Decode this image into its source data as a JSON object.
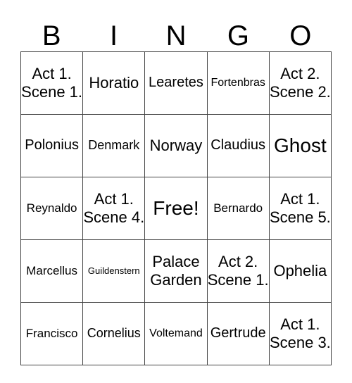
{
  "header": [
    "B",
    "I",
    "N",
    "G",
    "O"
  ],
  "rows": [
    [
      "Act 1. Scene 1.",
      "Horatio",
      "Learetes",
      "Fortenbras",
      "Act 2. Scene 2."
    ],
    [
      "Polonius",
      "Denmark",
      "Norway",
      "Claudius",
      "Ghost"
    ],
    [
      "Reynaldo",
      "Act 1. Scene 4.",
      "Free!",
      "Bernardo",
      "Act 1. Scene 5."
    ],
    [
      "Marcellus",
      "Guildenstern",
      "Palace Garden",
      "Act 2. Scene 1.",
      "Ophelia"
    ],
    [
      "Francisco",
      "Cornelius",
      "Voltemand",
      "Gertrude",
      "Act 1. Scene 3."
    ]
  ]
}
